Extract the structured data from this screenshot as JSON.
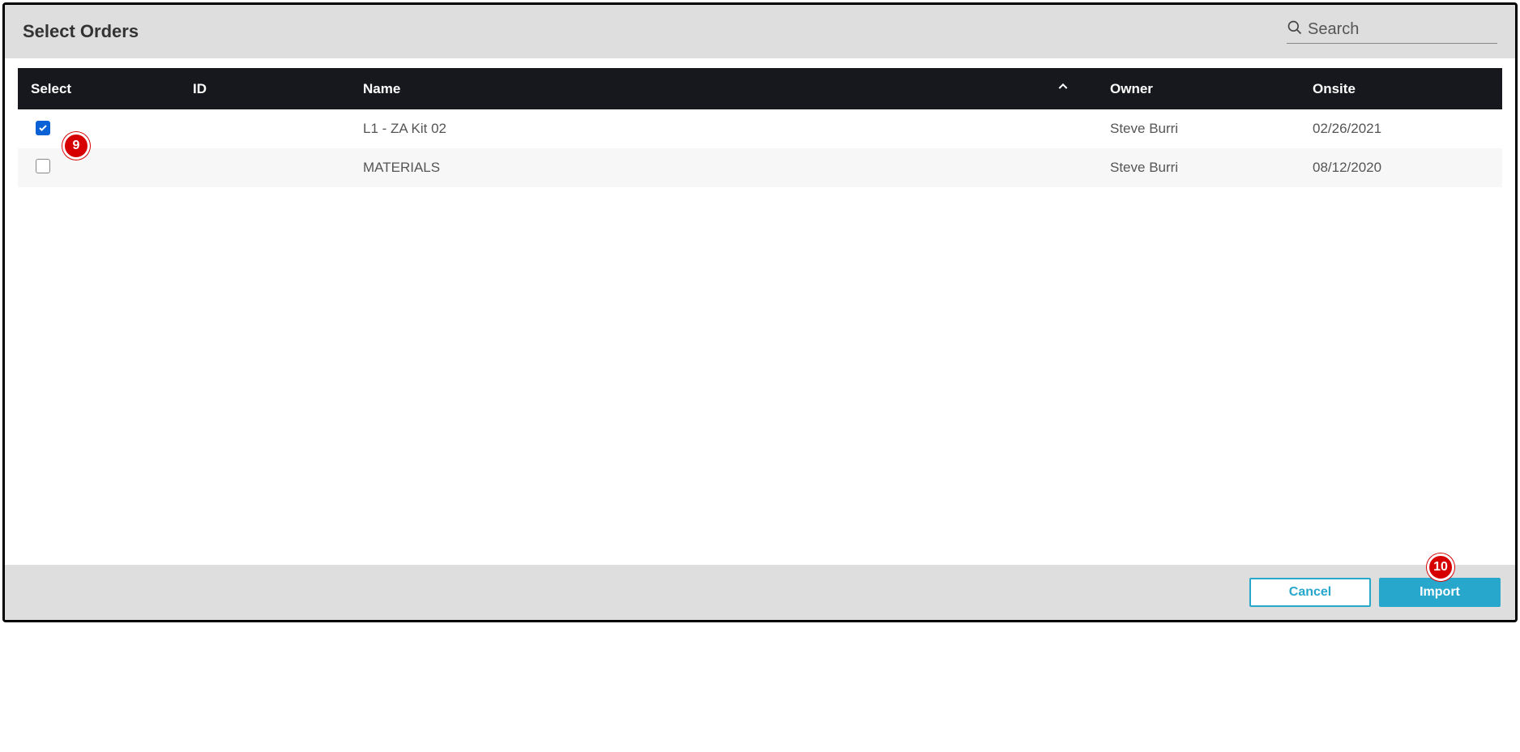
{
  "dialog": {
    "title": "Select Orders",
    "search_placeholder": "Search"
  },
  "table": {
    "headers": {
      "select": "Select",
      "id": "ID",
      "name": "Name",
      "owner": "Owner",
      "onsite": "Onsite"
    },
    "rows": [
      {
        "selected": true,
        "id": "",
        "name": "L1 - ZA Kit 02",
        "owner": "Steve Burri",
        "onsite": "02/26/2021"
      },
      {
        "selected": false,
        "id": "",
        "name": "MATERIALS",
        "owner": "Steve Burri",
        "onsite": "08/12/2020"
      }
    ]
  },
  "footer": {
    "cancel": "Cancel",
    "import": "Import"
  },
  "markers": {
    "nine": "9",
    "ten": "10"
  }
}
